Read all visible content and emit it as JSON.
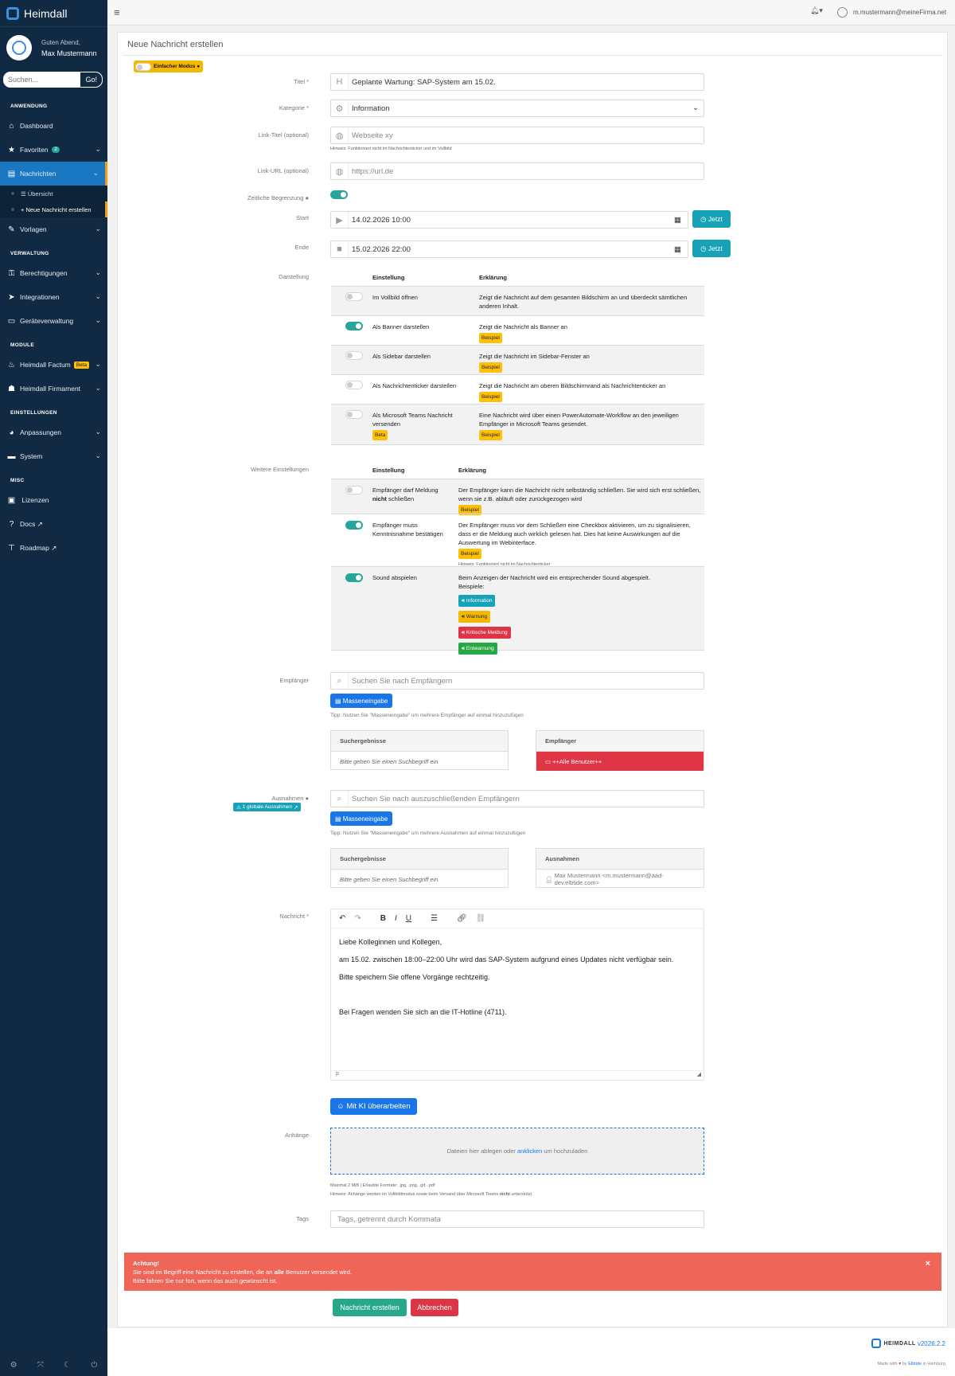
{
  "app": {
    "title": "Heimdall"
  },
  "user": {
    "greeting": "Guten Abend,",
    "name": "Max Mustermann",
    "email": "m.mustermann@meineFirma.net"
  },
  "sidebar": {
    "search_placeholder": "Suchen...",
    "go_label": "Go!",
    "sections": {
      "anwendung": "ANWENDUNG",
      "verwaltung": "VERWALTUNG",
      "module": "MODULE",
      "einstellungen": "EINSTELLUNGEN",
      "misc": "MISC"
    },
    "items": {
      "dashboard": "Dashboard",
      "favoriten": "Favoriten",
      "favoriten_count": "2",
      "nachrichten": "Nachrichten",
      "uebersicht": "Übersicht",
      "neue": "Neue Nachricht erstellen",
      "vorlagen": "Vorlagen",
      "berechtigungen": "Berechtigungen",
      "integrationen": "Integrationen",
      "geraete": "Geräteverwaltung",
      "factum": "Heimdall Factum",
      "beta": "Beta",
      "firmament": "Heimdall Firmament",
      "anpassungen": "Anpassungen",
      "system": "System",
      "lizenzen": "Lizenzen",
      "docs": "Docs",
      "roadmap": "Roadmap"
    }
  },
  "page": {
    "title": "Neue Nachricht erstellen",
    "mode_label": "Einfacher Modus"
  },
  "form": {
    "titel_label": "Titel",
    "titel_value": "Geplante Wartung: SAP-System am 15.02.",
    "kategorie_label": "Kategorie",
    "kategorie_value": "Information",
    "linktitel_label": "Link-Titel (optional)",
    "linktitel_placeholder": "Webseite xy",
    "linktitel_hint": "Hinweis: Funktioniert nicht im Nachrichtenticker und im Vollbild",
    "linkurl_label": "Link-URL (optional)",
    "linkurl_placeholder": "https://url.de",
    "zeit_label": "Zeitliche Begrenzung",
    "start_label": "Start",
    "start_value": "14.02.2026 10:00",
    "ende_label": "Ende",
    "ende_value": "15.02.2026 22:00",
    "jetzt_label": "Jetzt",
    "darstellung_label": "Darstellung",
    "col_einstellung": "Einstellung",
    "col_erklaerung": "Erklärung",
    "beispiel": "Beispiel",
    "d1_name": "Im Vollbild öffnen",
    "d1_desc": "Zeigt die Nachricht auf dem gesamten Bildschirm an und überdeckt sämtlichen anderen Inhalt.",
    "d2_name": "Als Banner darstellen",
    "d2_desc": "Zeigt die Nachricht als Banner an",
    "d3_name": "Als Sidebar darstellen",
    "d3_desc": "Zeigt die Nachricht im Sidebar-Fenster an",
    "d4_name": "Als Nachrichtenticker darstellen",
    "d4_desc": "Zeigt die Nachricht am oberen Bildschirmrand als Nachrichtenticker an",
    "d5_name": "Als Microsoft Teams Nachricht versenden",
    "d5_beta": "Beta",
    "d5_desc": "Eine Nachricht wird über einen PowerAutomate-Workflow an den jeweiligen Empfänger in Microsoft Teams gesendet.",
    "weitere_label": "Weitere Einstellungen",
    "w1_name_a": "Empfänger darf Meldung",
    "w1_name_b": "nicht",
    "w1_name_c": "schließen",
    "w1_desc": "Der Empfänger kann die Nachricht nicht selbständig schließen. Sie wird sich erst schließen, wenn sie z.B. abläuft oder zurückgezogen wird",
    "w2_name": "Empfänger muss Kenntnisnahme bestätigen",
    "w2_desc": "Der Empfänger muss vor dem Schließen eine Checkbox aktivieren, um zu signalisieren, dass er die Meldung auch wirklich gelesen hat. Dies hat keine Auswirkungen auf die Auswertung im Webinterface.",
    "w2_hint": "Hinweis: Funktioniert nicht im Nachrichtenticker",
    "w3_name": "Sound abspielen",
    "w3_desc": "Beim Anzeigen der Nachricht wird ein entsprechender Sound abgespielt.",
    "w3_beispiele": "Beispiele:",
    "sound_information": "Information",
    "sound_warnung": "Warnung",
    "sound_kritisch": "Kritische Meldung",
    "sound_entwarnung": "Entwarnung",
    "empf_label": "Empfänger",
    "empf_placeholder": "Suchen Sie nach Empfängern",
    "masse_label": "Masseneingabe",
    "empf_tip": "Tipp: Nutzen Sie \"Masseneingabe\" um mehrere Empfänger auf einmal hinzuzufügen",
    "suchergebnisse": "Suchergebnisse",
    "suchhint": "Bitte geben Sie einen Suchbegriff ein",
    "empfaenger_head": "Empfänger",
    "alle_benutzer": "++Alle Benutzer++",
    "ausn_label": "Ausnahmen",
    "ausn_badge": "1 globale Ausnahmen",
    "ausn_placeholder": "Suchen Sie nach auszuschließenden Empfängern",
    "ausn_tip": "Tipp: Nutzen Sie \"Masseneingabe\" um mehrere Ausnahmen auf einmal hinzuzufügen",
    "ausn_head": "Ausnahmen",
    "ausn_entry": "Max Mustermann <m.mustermann@aad-dev.elbtide.com>",
    "nachricht_label": "Nachricht",
    "msg_l1": "Liebe Kolleginnen und Kollegen,",
    "msg_l2": "am 15.02. zwischen 18:00–22:00 Uhr wird das SAP-System aufgrund eines Updates nicht verfügbar sein.",
    "msg_l3": "Bitte speichern Sie offene Vorgänge rechtzeitig.",
    "msg_l4": "Bei Fragen wenden Sie sich an die IT-Hotline (4711).",
    "editor_path": "p",
    "ki_label": "Mit KI überarbeiten",
    "anhaenge_label": "Anhänge",
    "drop_a": "Dateien hier ablegen oder",
    "drop_link": "anklicken",
    "drop_b": "um hochzuladen",
    "anh_info": "Maximal 2 MiB | Erlaubte Formate: .jpg, .png, .gif, .pdf",
    "anh_hint_a": "Hinweis: Anhänge werden im Vollbildmodus sowie beim Versand über Microsoft Teams",
    "anh_hint_b": "nicht",
    "anh_hint_c": "unterstützt",
    "tags_label": "Tags",
    "tags_placeholder": "Tags, getrennt durch Kommata"
  },
  "alert": {
    "title": "Achtung!",
    "line1_a": "Sie sind im Begriff eine Nachricht zu erstellen, die an",
    "line1_b": "alle",
    "line1_c": "Benutzer versendet wird.",
    "line2": "Bitte fahren Sie nur fort, wenn das auch gewünscht ist."
  },
  "actions": {
    "create": "Nachricht erstellen",
    "cancel": "Abbrechen"
  },
  "footer": {
    "brand": "HEIMDALL",
    "version": "v2026.2.2",
    "made_a": "Made with",
    "made_b": "by",
    "made_link": "Elbtide",
    "made_c": "in Hamburg"
  },
  "colors": {
    "sidebar": "#0f2a42",
    "primary": "#1a76e8",
    "teal": "#17a2b8",
    "toggle_on": "#26a69a",
    "danger": "#e03545",
    "alert": "#ef6557",
    "create": "#28a88a"
  }
}
